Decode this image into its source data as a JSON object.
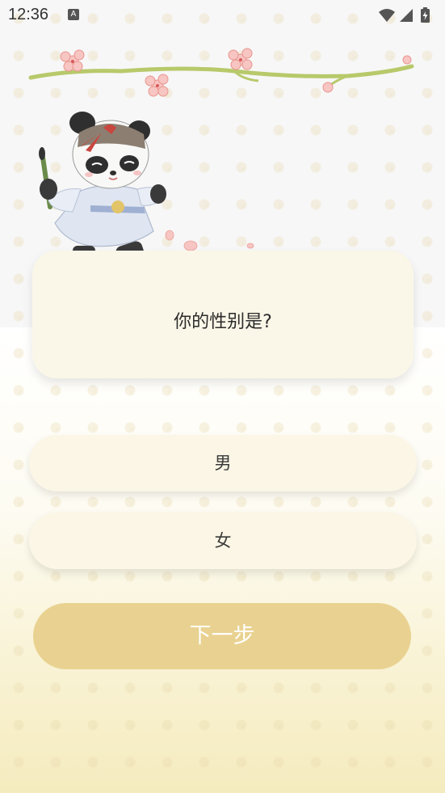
{
  "status_bar": {
    "time": "12:36",
    "notification_badge": "A"
  },
  "question": {
    "text": "你的性别是?"
  },
  "options": [
    {
      "label": "男"
    },
    {
      "label": "女"
    }
  ],
  "next_button": {
    "label": "下一步"
  },
  "colors": {
    "card_bg": "#fbf7e8",
    "option_bg": "#fbf6e5",
    "next_button_bg": "#e9d291",
    "petal": "#f7c5c2",
    "branch": "#b7c96a"
  }
}
